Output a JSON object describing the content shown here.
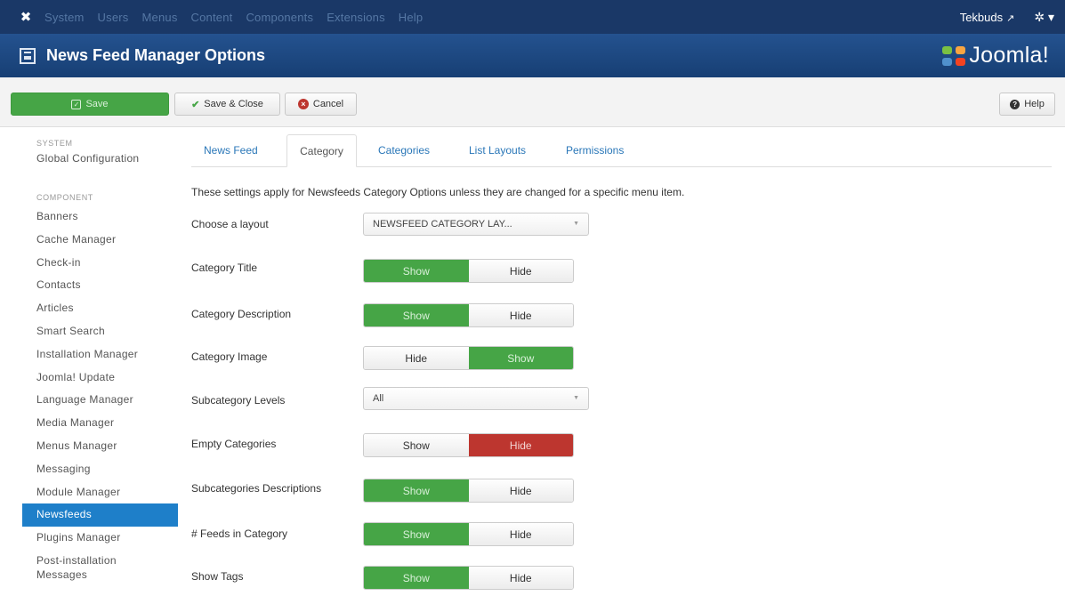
{
  "topnav": {
    "menu": [
      "System",
      "Users",
      "Menus",
      "Content",
      "Components",
      "Extensions",
      "Help"
    ],
    "user": "Tekbuds",
    "user_icon": "external-link-icon",
    "settings_icon": "gear-icon"
  },
  "titlebar": {
    "title": "News Feed Manager Options",
    "brand": "Joomla!"
  },
  "toolbar": {
    "save": "Save",
    "save_close": "Save & Close",
    "cancel": "Cancel",
    "help": "Help"
  },
  "sidebar": {
    "system_header": "SYSTEM",
    "global_config": "Global Configuration",
    "component_header": "COMPONENT",
    "items": [
      "Banners",
      "Cache Manager",
      "Check-in",
      "Contacts",
      "Articles",
      "Smart Search",
      "Installation Manager",
      "Joomla! Update",
      "Language Manager",
      "Media Manager",
      "Menus Manager",
      "Messaging",
      "Module Manager",
      "Newsfeeds",
      "Plugins Manager",
      "Post-installation Messages"
    ],
    "active_item": "Newsfeeds"
  },
  "tabs": [
    "News Feed",
    "Category",
    "Categories",
    "List Layouts",
    "Permissions"
  ],
  "active_tab": "Category",
  "intro": "These settings apply for Newsfeeds Category Options unless they are changed for a specific menu item.",
  "fields": {
    "layout": {
      "label": "Choose a layout",
      "value": "NEWSFEED CATEGORY LAY..."
    },
    "category_title": {
      "label": "Category Title",
      "left": "Show",
      "right": "Hide",
      "selected": "Show"
    },
    "category_description": {
      "label": "Category Description",
      "left": "Show",
      "right": "Hide",
      "selected": "Show"
    },
    "category_image": {
      "label": "Category Image",
      "left": "Hide",
      "right": "Show",
      "selected": "Show"
    },
    "subcategory_levels": {
      "label": "Subcategory Levels",
      "value": "All"
    },
    "empty_categories": {
      "label": "Empty Categories",
      "left": "Show",
      "right": "Hide",
      "selected": "Hide"
    },
    "subcategories_descriptions": {
      "label": "Subcategories Descriptions",
      "left": "Show",
      "right": "Hide",
      "selected": "Show"
    },
    "feeds_in_category": {
      "label": "# Feeds in Category",
      "left": "Show",
      "right": "Hide",
      "selected": "Show"
    },
    "show_tags": {
      "label": "Show Tags",
      "left": "Show",
      "right": "Hide",
      "selected": "Show"
    }
  },
  "colors": {
    "nav_bg": "#1a3867",
    "title_bg": "#1e4c86",
    "green": "#46a546",
    "red": "#bd362f",
    "active_blue": "#1e7fc9",
    "link_blue": "#2a77b8"
  }
}
